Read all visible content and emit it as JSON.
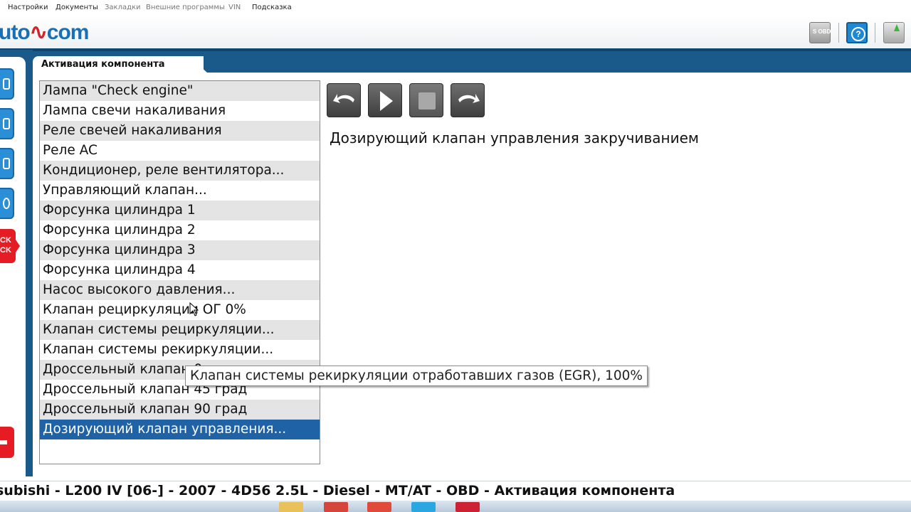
{
  "menu": {
    "items": [
      "Настройки",
      "Документы",
      "Закладки",
      "Внешние программы",
      "VIN",
      "Подсказка"
    ]
  },
  "header": {
    "logo_text": "uto",
    "logo_suffix": "com",
    "icons": [
      "obd-icon",
      "help-icon",
      "battery-icon"
    ],
    "obd_icon_text": "S OBD"
  },
  "sidebar": {
    "items": [
      "engine-icon",
      "transmission-icon",
      "report-icon",
      "tools-icon",
      "check-engine-icon",
      "exit-icon"
    ],
    "check_label_1": "CK",
    "check_label_2": "CK"
  },
  "main": {
    "tab_title": "Активация компонента",
    "list": [
      "Лампа \"Check engine\"",
      "Лампа свечи накаливания",
      "Реле свечей накаливания",
      "Реле AC",
      "Кондиционер,  реле  вентилятора...",
      "Управляющий  клапан...",
      "Форсунка цилиндра 1",
      "Форсунка цилиндра 2",
      "Форсунка цилиндра 3",
      "Форсунка цилиндра 4",
      "Насос  высокого  давления...",
      "Клапан рециркуляции ОГ 0%",
      "Клапан  системы  рециркуляции...",
      "Клапан  системы  рекиркуляции...",
      "Дроссельный клапан 0",
      "Дроссельный клапан 45 град",
      "Дроссельный клапан 90 град",
      "Дозирующий  клапан  управления..."
    ],
    "selected_index": 17,
    "toolbar": [
      "back-icon",
      "play-icon",
      "stop-icon",
      "forward-icon"
    ],
    "description": "Дозирующий клапан управления закручиванием",
    "tooltip": "Клапан системы рекиркуляции отработавших газов (EGR), 100%"
  },
  "status": {
    "text": "subishi - L200 IV [06-] - 2007 - 4D56 2.5L - Diesel - MT/AT - OBD - Активация компонента"
  },
  "colors": {
    "brand_blue": "#1a5a8a",
    "selection": "#1f62a6",
    "accent_red": "#e51c23"
  }
}
